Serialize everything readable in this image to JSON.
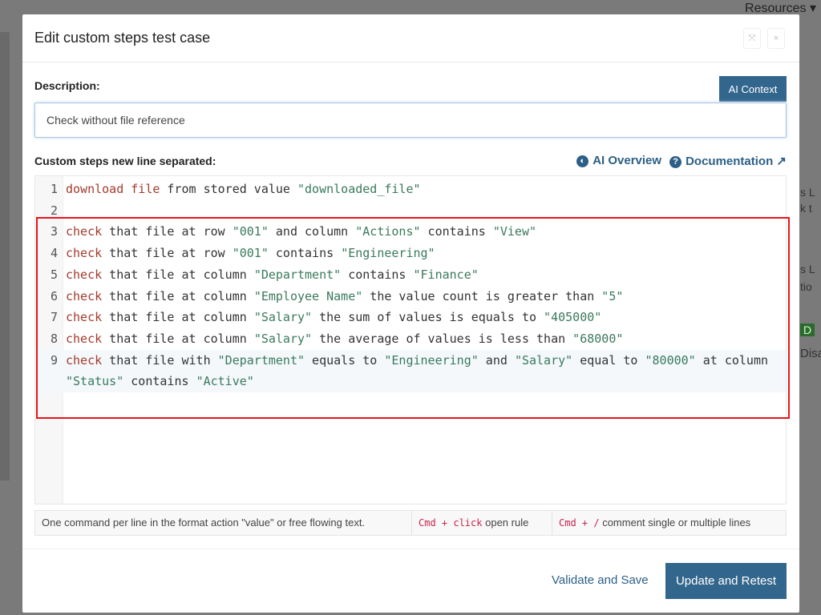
{
  "background": {
    "resources_menu": "Resources ▾",
    "fragments": [
      "s L",
      "k t",
      "s L",
      "tio",
      "D",
      "Disa"
    ]
  },
  "modal": {
    "title": "Edit custom steps test case",
    "header_buttons": [
      "⤧",
      "×"
    ],
    "description_label": "Description:",
    "ai_context_label": "AI Context",
    "description_value": "Check without file reference",
    "steps_label": "Custom steps new line separated:",
    "ai_overview_label": "AI Overview",
    "documentation_label": "Documentation",
    "code_lines": [
      [
        {
          "t": "download file",
          "k": "kw"
        },
        {
          "t": " from stored value "
        },
        {
          "t": "\"downloaded_file\"",
          "k": "str"
        }
      ],
      [],
      [
        {
          "t": "check",
          "k": "kw"
        },
        {
          "t": " that file at row "
        },
        {
          "t": "\"001\"",
          "k": "str"
        },
        {
          "t": " and column "
        },
        {
          "t": "\"Actions\"",
          "k": "str"
        },
        {
          "t": " contains "
        },
        {
          "t": "\"View\"",
          "k": "str"
        }
      ],
      [
        {
          "t": "check",
          "k": "kw"
        },
        {
          "t": " that file at row "
        },
        {
          "t": "\"001\"",
          "k": "str"
        },
        {
          "t": " contains "
        },
        {
          "t": "\"Engineering\"",
          "k": "str"
        }
      ],
      [
        {
          "t": "check",
          "k": "kw"
        },
        {
          "t": " that file at column "
        },
        {
          "t": "\"Department\"",
          "k": "str"
        },
        {
          "t": " contains "
        },
        {
          "t": "\"Finance\"",
          "k": "str"
        }
      ],
      [
        {
          "t": "check",
          "k": "kw"
        },
        {
          "t": " that file at column "
        },
        {
          "t": "\"Employee Name\"",
          "k": "str"
        },
        {
          "t": " the value count is greater than "
        },
        {
          "t": "\"5\"",
          "k": "str"
        }
      ],
      [
        {
          "t": "check",
          "k": "kw"
        },
        {
          "t": " that file at column "
        },
        {
          "t": "\"Salary\"",
          "k": "str"
        },
        {
          "t": " the sum of values is equals to "
        },
        {
          "t": "\"405000\"",
          "k": "str"
        }
      ],
      [
        {
          "t": "check",
          "k": "kw"
        },
        {
          "t": " that file at column "
        },
        {
          "t": "\"Salary\"",
          "k": "str"
        },
        {
          "t": " the average of values is less than "
        },
        {
          "t": "\"68000\"",
          "k": "str"
        }
      ],
      [
        {
          "t": "check",
          "k": "kw"
        },
        {
          "t": " that file with "
        },
        {
          "t": "\"Department\"",
          "k": "str"
        },
        {
          "t": " equals to "
        },
        {
          "t": "\"Engineering\"",
          "k": "str"
        },
        {
          "t": " and "
        },
        {
          "t": "\"Salary\"",
          "k": "str"
        },
        {
          "t": " equal to "
        },
        {
          "t": "\"80000\"",
          "k": "str"
        },
        {
          "t": " at column "
        },
        {
          "t": "\"Status\"",
          "k": "str"
        },
        {
          "t": " contains "
        },
        {
          "t": "\"Active\"",
          "k": "str"
        }
      ]
    ],
    "hints": {
      "format": "One command per line in the format action \"value\" or free flowing text.",
      "open_key": "Cmd + click",
      "open_text": "open rule",
      "comment_key": "Cmd + /",
      "comment_text": "comment single or multiple lines"
    },
    "validate_label": "Validate and Save",
    "update_label": "Update and Retest"
  }
}
